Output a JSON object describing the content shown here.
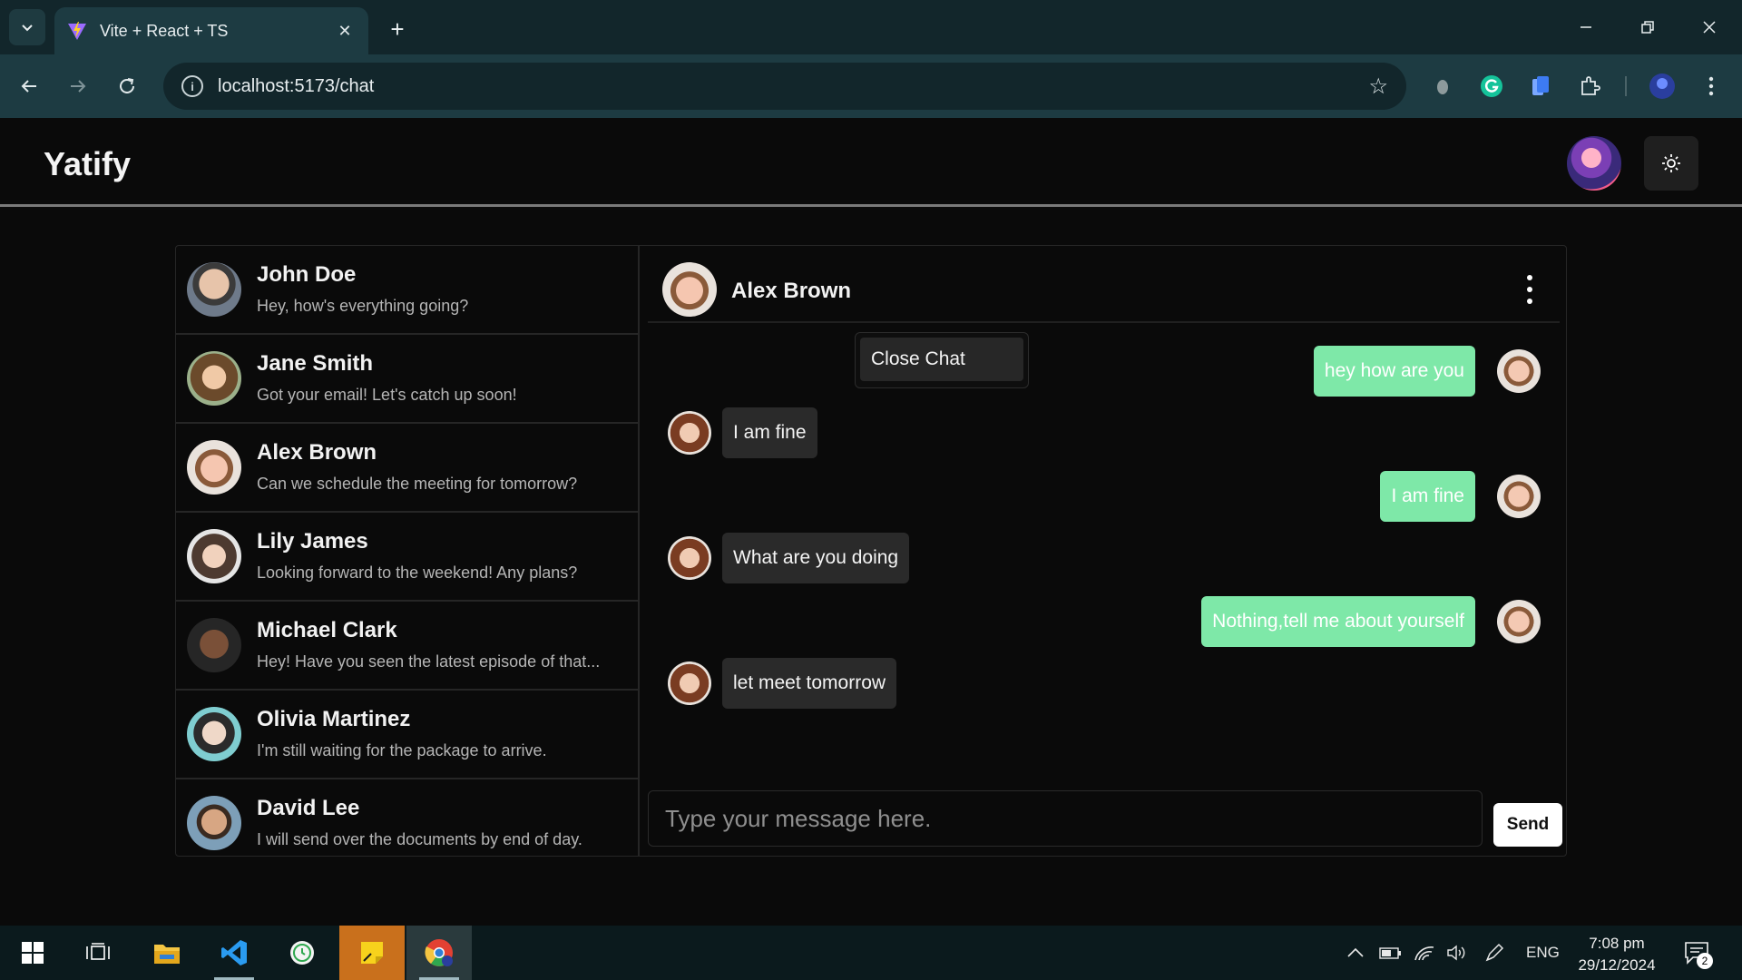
{
  "browser": {
    "tab_title": "Vite + React + TS",
    "url": "localhost:5173/chat"
  },
  "app": {
    "brand": "Yatify"
  },
  "contacts": [
    {
      "name": "John Doe",
      "message": "Hey, how's everything going?"
    },
    {
      "name": "Jane Smith",
      "message": "Got your email! Let's catch up soon!"
    },
    {
      "name": "Alex Brown",
      "message": "Can we schedule the meeting for tomorrow?"
    },
    {
      "name": "Lily James",
      "message": "Looking forward to the weekend! Any plans?"
    },
    {
      "name": "Michael Clark",
      "message": "Hey! Have you seen the latest episode of that..."
    },
    {
      "name": "Olivia Martinez",
      "message": "I'm still waiting for the package to arrive."
    },
    {
      "name": "David Lee",
      "message": "I will send over the documents by end of day."
    }
  ],
  "chat": {
    "contact_name": "Alex Brown",
    "menu_item": "Close Chat",
    "messages": [
      {
        "from": "me",
        "text": "hey how are you"
      },
      {
        "from": "them",
        "text": "I am fine"
      },
      {
        "from": "me",
        "text": "I am fine"
      },
      {
        "from": "them",
        "text": "What are you doing"
      },
      {
        "from": "me",
        "text": "Nothing,tell me about yourself"
      },
      {
        "from": "them",
        "text": "let meet tomorrow"
      }
    ],
    "input_placeholder": "Type your message here.",
    "send_label": "Send"
  },
  "colors": {
    "outgoing_bubble": "#7ee8a8",
    "incoming_bubble": "#2a2a2a"
  },
  "taskbar": {
    "language": "ENG",
    "time": "7:08 pm",
    "date": "29/12/2024",
    "notification_count": "2"
  }
}
